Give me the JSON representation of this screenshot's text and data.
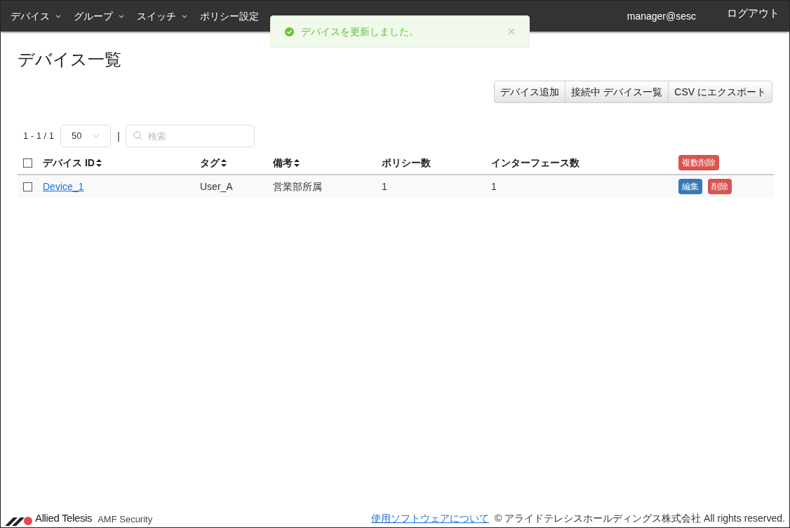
{
  "nav": {
    "items": [
      {
        "label": "デバイス",
        "dropdown": true
      },
      {
        "label": "グループ",
        "dropdown": true
      },
      {
        "label": "スイッチ",
        "dropdown": true
      },
      {
        "label": "ポリシー設定",
        "dropdown": false
      }
    ],
    "user": "manager@sesc",
    "logout": "ログアウト"
  },
  "toast": {
    "message": "デバイスを更新しました。"
  },
  "page": {
    "title": "デバイス一覧",
    "buttons": [
      "デバイス追加",
      "接続中 デバイス一覧",
      "CSV にエクスポート"
    ]
  },
  "pager": {
    "range": "1 - 1 / 1",
    "page_size": "50",
    "separator": "|",
    "search_placeholder": "検索"
  },
  "table": {
    "select_all": {
      "checked": false
    },
    "columns": [
      {
        "label": "デバイス ID",
        "sortable": true
      },
      {
        "label": "タグ",
        "sortable": true
      },
      {
        "label": "備考",
        "sortable": true
      },
      {
        "label": "ポリシー数",
        "sortable": false
      },
      {
        "label": "インターフェース数",
        "sortable": false
      }
    ],
    "bulk_delete": "複数削除",
    "rows": [
      {
        "checked": false,
        "cells": [
          "Device_1",
          "User_A",
          "営業部所属",
          "1",
          "1"
        ],
        "edit": "編集",
        "delete": "削除"
      }
    ]
  },
  "footer": {
    "brand": "Allied Telesis",
    "product": "AMF Security",
    "link": "使用ソフトウェアについて",
    "copyright": "© アライドテレシスホールディングス株式会社 All rights reserved."
  }
}
